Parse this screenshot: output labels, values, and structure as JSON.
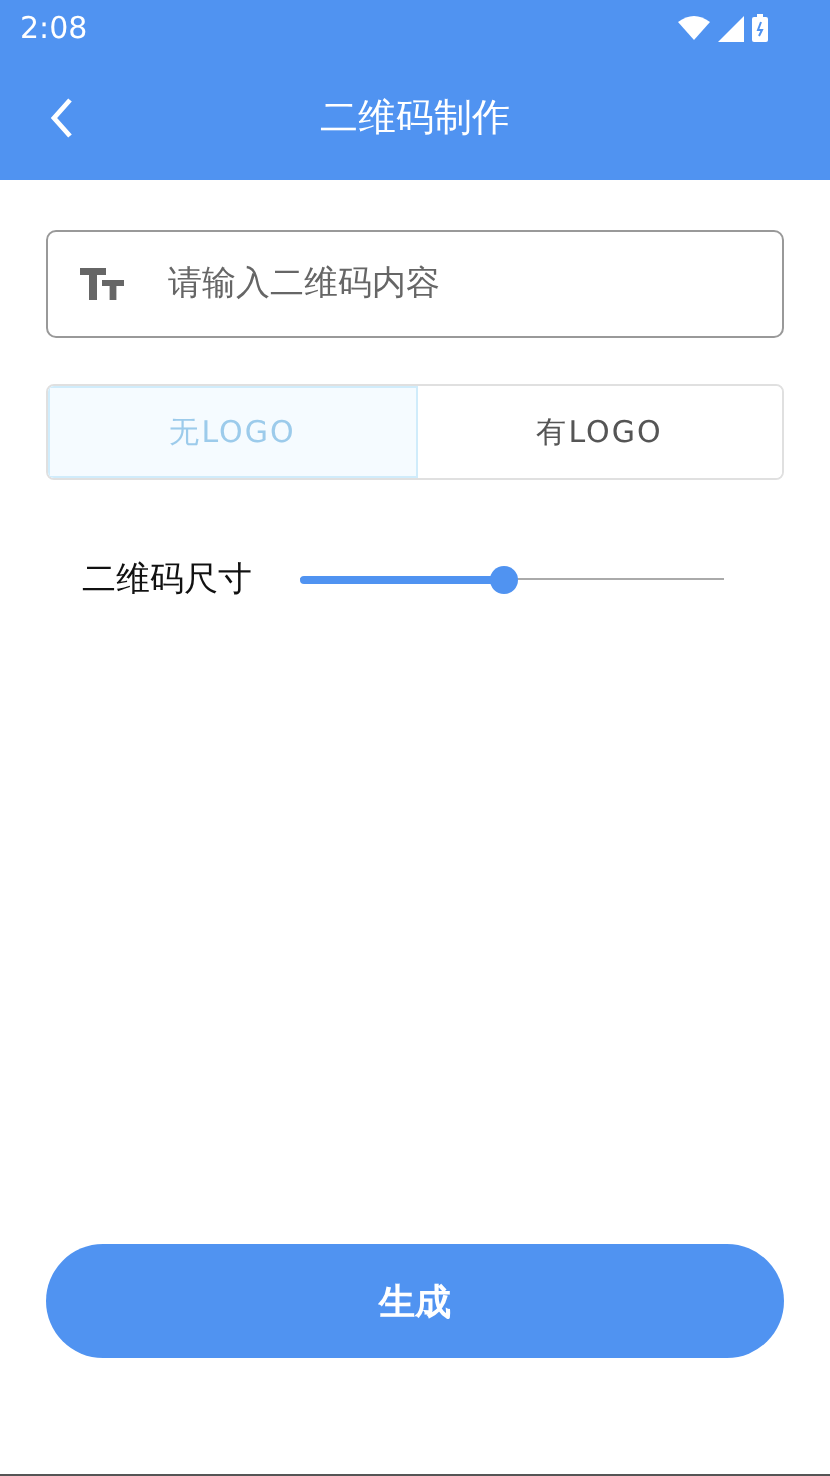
{
  "status_bar": {
    "time": "2:08"
  },
  "header": {
    "title": "二维码制作"
  },
  "content_field": {
    "placeholder": "请输入二维码内容"
  },
  "logo_options": [
    {
      "label": "无LOGO",
      "selected": true
    },
    {
      "label": "有LOGO",
      "selected": false
    }
  ],
  "size_slider": {
    "label": "二维码尺寸",
    "level": 0.48
  },
  "generate_button": {
    "label": "生成"
  }
}
